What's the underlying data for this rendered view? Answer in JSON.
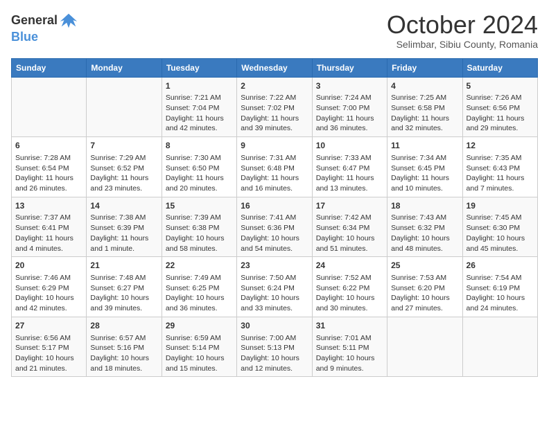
{
  "header": {
    "logo_general": "General",
    "logo_blue": "Blue",
    "month_title": "October 2024",
    "subtitle": "Selimbar, Sibiu County, Romania"
  },
  "days_of_week": [
    "Sunday",
    "Monday",
    "Tuesday",
    "Wednesday",
    "Thursday",
    "Friday",
    "Saturday"
  ],
  "weeks": [
    [
      {
        "day": "",
        "content": ""
      },
      {
        "day": "",
        "content": ""
      },
      {
        "day": "1",
        "content": "Sunrise: 7:21 AM\nSunset: 7:04 PM\nDaylight: 11 hours and 42 minutes."
      },
      {
        "day": "2",
        "content": "Sunrise: 7:22 AM\nSunset: 7:02 PM\nDaylight: 11 hours and 39 minutes."
      },
      {
        "day": "3",
        "content": "Sunrise: 7:24 AM\nSunset: 7:00 PM\nDaylight: 11 hours and 36 minutes."
      },
      {
        "day": "4",
        "content": "Sunrise: 7:25 AM\nSunset: 6:58 PM\nDaylight: 11 hours and 32 minutes."
      },
      {
        "day": "5",
        "content": "Sunrise: 7:26 AM\nSunset: 6:56 PM\nDaylight: 11 hours and 29 minutes."
      }
    ],
    [
      {
        "day": "6",
        "content": "Sunrise: 7:28 AM\nSunset: 6:54 PM\nDaylight: 11 hours and 26 minutes."
      },
      {
        "day": "7",
        "content": "Sunrise: 7:29 AM\nSunset: 6:52 PM\nDaylight: 11 hours and 23 minutes."
      },
      {
        "day": "8",
        "content": "Sunrise: 7:30 AM\nSunset: 6:50 PM\nDaylight: 11 hours and 20 minutes."
      },
      {
        "day": "9",
        "content": "Sunrise: 7:31 AM\nSunset: 6:48 PM\nDaylight: 11 hours and 16 minutes."
      },
      {
        "day": "10",
        "content": "Sunrise: 7:33 AM\nSunset: 6:47 PM\nDaylight: 11 hours and 13 minutes."
      },
      {
        "day": "11",
        "content": "Sunrise: 7:34 AM\nSunset: 6:45 PM\nDaylight: 11 hours and 10 minutes."
      },
      {
        "day": "12",
        "content": "Sunrise: 7:35 AM\nSunset: 6:43 PM\nDaylight: 11 hours and 7 minutes."
      }
    ],
    [
      {
        "day": "13",
        "content": "Sunrise: 7:37 AM\nSunset: 6:41 PM\nDaylight: 11 hours and 4 minutes."
      },
      {
        "day": "14",
        "content": "Sunrise: 7:38 AM\nSunset: 6:39 PM\nDaylight: 11 hours and 1 minute."
      },
      {
        "day": "15",
        "content": "Sunrise: 7:39 AM\nSunset: 6:38 PM\nDaylight: 10 hours and 58 minutes."
      },
      {
        "day": "16",
        "content": "Sunrise: 7:41 AM\nSunset: 6:36 PM\nDaylight: 10 hours and 54 minutes."
      },
      {
        "day": "17",
        "content": "Sunrise: 7:42 AM\nSunset: 6:34 PM\nDaylight: 10 hours and 51 minutes."
      },
      {
        "day": "18",
        "content": "Sunrise: 7:43 AM\nSunset: 6:32 PM\nDaylight: 10 hours and 48 minutes."
      },
      {
        "day": "19",
        "content": "Sunrise: 7:45 AM\nSunset: 6:30 PM\nDaylight: 10 hours and 45 minutes."
      }
    ],
    [
      {
        "day": "20",
        "content": "Sunrise: 7:46 AM\nSunset: 6:29 PM\nDaylight: 10 hours and 42 minutes."
      },
      {
        "day": "21",
        "content": "Sunrise: 7:48 AM\nSunset: 6:27 PM\nDaylight: 10 hours and 39 minutes."
      },
      {
        "day": "22",
        "content": "Sunrise: 7:49 AM\nSunset: 6:25 PM\nDaylight: 10 hours and 36 minutes."
      },
      {
        "day": "23",
        "content": "Sunrise: 7:50 AM\nSunset: 6:24 PM\nDaylight: 10 hours and 33 minutes."
      },
      {
        "day": "24",
        "content": "Sunrise: 7:52 AM\nSunset: 6:22 PM\nDaylight: 10 hours and 30 minutes."
      },
      {
        "day": "25",
        "content": "Sunrise: 7:53 AM\nSunset: 6:20 PM\nDaylight: 10 hours and 27 minutes."
      },
      {
        "day": "26",
        "content": "Sunrise: 7:54 AM\nSunset: 6:19 PM\nDaylight: 10 hours and 24 minutes."
      }
    ],
    [
      {
        "day": "27",
        "content": "Sunrise: 6:56 AM\nSunset: 5:17 PM\nDaylight: 10 hours and 21 minutes."
      },
      {
        "day": "28",
        "content": "Sunrise: 6:57 AM\nSunset: 5:16 PM\nDaylight: 10 hours and 18 minutes."
      },
      {
        "day": "29",
        "content": "Sunrise: 6:59 AM\nSunset: 5:14 PM\nDaylight: 10 hours and 15 minutes."
      },
      {
        "day": "30",
        "content": "Sunrise: 7:00 AM\nSunset: 5:13 PM\nDaylight: 10 hours and 12 minutes."
      },
      {
        "day": "31",
        "content": "Sunrise: 7:01 AM\nSunset: 5:11 PM\nDaylight: 10 hours and 9 minutes."
      },
      {
        "day": "",
        "content": ""
      },
      {
        "day": "",
        "content": ""
      }
    ]
  ]
}
